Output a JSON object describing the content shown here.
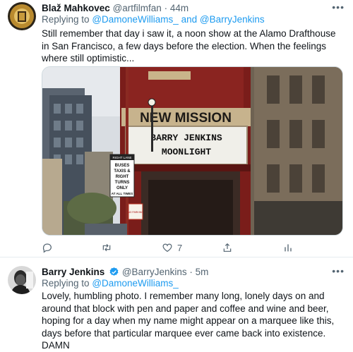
{
  "tweets": [
    {
      "author_name": "Blaž Mahkovec",
      "handle": "@artfilmfan",
      "separator": "·",
      "time": "44m",
      "replying_prefix": "Replying to",
      "reply_to_1": "@DamoneWilliams_",
      "reply_and": "and",
      "reply_to_2": "@BarryJenkins",
      "text": "Still remember that day i saw it, a noon show at the Alamo Drafthouse in San Francisco, a few days before the election. When the feelings where still optimistic...",
      "media": {
        "marquee_title": "NEW MISSION",
        "marquee_line1": "BARRY JENKINS",
        "marquee_line2": "MOONLIGHT",
        "sign_label": "RIGHT LANE",
        "sign_text_1": "BUSES",
        "sign_text_2": "TAXIS &",
        "sign_text_3": "RIGHT",
        "sign_text_4": "TURNS",
        "sign_text_5": "ONLY",
        "sign_text_6": "AT ALL TIMES",
        "sign_no_parking": "NO PARKING"
      },
      "actions": {
        "reply_count": "",
        "retweet_count": "",
        "like_count": "7"
      }
    },
    {
      "author_name": "Barry Jenkins",
      "handle": "@BarryJenkins",
      "separator": "·",
      "time": "5m",
      "replying_prefix": "Replying to",
      "reply_to_1": "@DamoneWilliams_",
      "text": "Lovely, humbling photo. I remember many long, lonely days on and around that block with pen and paper and coffee and wine and beer, hoping for a day when my name might appear on a marquee like this, days before that particular marquee ever came back into existence. DAMN"
    }
  ],
  "icons": {
    "more": "more-dots-icon",
    "reply": "reply-bubble-icon",
    "retweet": "retweet-icon",
    "like": "heart-icon",
    "share": "share-icon",
    "analytics": "analytics-bars-icon",
    "verified": "verified-badge-icon"
  },
  "colors": {
    "link": "#1d9bf0",
    "secondary_text": "#536471",
    "marquee_red": "#8a1e1c",
    "verified_blue": "#1d9bf0"
  }
}
